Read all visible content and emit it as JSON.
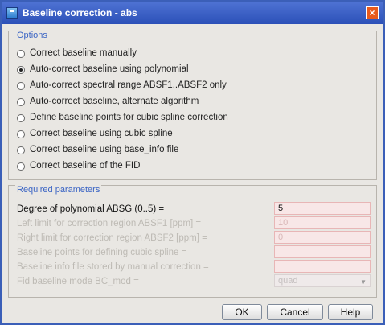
{
  "window": {
    "title": "Baseline correction - abs",
    "close_glyph": "×"
  },
  "options": {
    "title": "Options",
    "items": [
      {
        "label": "Correct baseline manually",
        "selected": false
      },
      {
        "label": "Auto-correct baseline using polynomial",
        "selected": true
      },
      {
        "label": "Auto-correct spectral range ABSF1..ABSF2 only",
        "selected": false
      },
      {
        "label": "Auto-correct baseline, alternate algorithm",
        "selected": false
      },
      {
        "label": "Define baseline points for cubic spline correction",
        "selected": false
      },
      {
        "label": "Correct baseline using cubic spline",
        "selected": false
      },
      {
        "label": "Correct baseline using base_info file",
        "selected": false
      },
      {
        "label": "Correct baseline of the FID",
        "selected": false
      }
    ]
  },
  "params": {
    "title": "Required parameters",
    "rows": [
      {
        "label": "Degree of polynomial ABSG (0..5) =",
        "value": "5",
        "enabled": true
      },
      {
        "label": "Left limit for correction region ABSF1 [ppm] =",
        "value": "10",
        "enabled": false
      },
      {
        "label": "Right limit for correction region ABSF2 [ppm] =",
        "value": "0",
        "enabled": false
      },
      {
        "label": "Baseline points for defining cubic spline =",
        "value": "",
        "enabled": false
      },
      {
        "label": "Baseline info file stored by manual correction =",
        "value": "",
        "enabled": false
      },
      {
        "label": "Fid baseline mode BC_mod =",
        "value": "quad",
        "enabled": false
      }
    ]
  },
  "buttons": {
    "ok": "OK",
    "cancel": "Cancel",
    "help": "Help"
  }
}
